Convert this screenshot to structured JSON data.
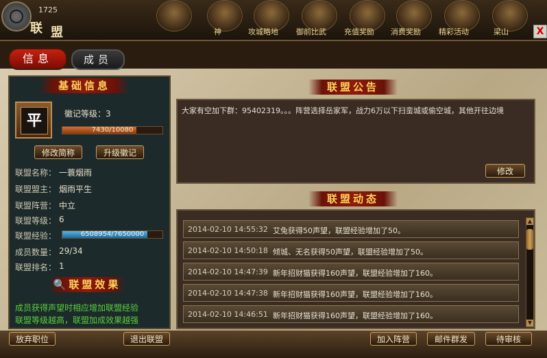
{
  "topbar": {
    "level": "1725",
    "title_char1": "联",
    "title_char2": "盟",
    "menu": [
      {
        "label": "",
        "icon": "portrait-icon"
      },
      {
        "label": "神",
        "icon": "weapon-icon"
      },
      {
        "label": "攻城略地",
        "icon": "jade-icon"
      },
      {
        "label": "御前比武",
        "icon": "dragon-icon"
      },
      {
        "label": "充值奖励",
        "icon": "gold-ingot-icon"
      },
      {
        "label": "消费奖励",
        "icon": "coin-icon"
      },
      {
        "label": "精彩活动",
        "icon": "gift-icon"
      },
      {
        "label": "梁山",
        "icon": "hero-icon"
      }
    ],
    "close": "X"
  },
  "tabs": {
    "info": "信息",
    "members": "成员"
  },
  "basic": {
    "banner": "基础信息",
    "badge_char": "平",
    "badge_level": "徽记等级：3",
    "badge_progress": "7430/10080",
    "badge_ratio": 0.737,
    "rename": "修改简称",
    "upgrade": "升级徽记",
    "fields": [
      {
        "label": "联盟名称：",
        "value": "一蓑烟雨"
      },
      {
        "label": "联盟盟主：",
        "value": "烟雨平生"
      },
      {
        "label": "联盟阵营：",
        "value": "中立"
      },
      {
        "label": "联盟等级：",
        "value": "6"
      },
      {
        "label": "联盟经验：",
        "value": ""
      },
      {
        "label": "成员数量：",
        "value": "29/34"
      },
      {
        "label": "联盟排名：",
        "value": "1"
      }
    ],
    "exp_progress": "6508954/7650000",
    "exp_ratio": 0.851,
    "effect_banner": "联盟效果",
    "effect_line1": "成员获得声望时相应增加联盟经验",
    "effect_line2": "联盟等级越高，联盟加成效果越强"
  },
  "announcement": {
    "banner": "联盟公告",
    "text": "大家有空加下群：95402319。。。阵营选择岳家军，战力6万以下扫蛮城或偷空城，其他开往边境",
    "modify": "修改"
  },
  "activity": {
    "banner": "联盟动态",
    "rows": [
      {
        "time": "2014-02-10  14:55:32",
        "text": "艾兔获得50声望，联盟经验增加了50。"
      },
      {
        "time": "2014-02-10  14:50:18",
        "text": "倾城、无名获得50声望，联盟经验增加了50。"
      },
      {
        "time": "2014-02-10  14:47:39",
        "text": "新年招财猫获得160声望，联盟经验增加了160。"
      },
      {
        "time": "2014-02-10  14:47:38",
        "text": "新年招财猫获得160声望，联盟经验增加了160。"
      },
      {
        "time": "2014-02-10  14:46:51",
        "text": "新年招财猫获得160声望，联盟经验增加了160。"
      }
    ]
  },
  "bottom": {
    "abandon": "放弃职位",
    "quit": "退出联盟",
    "join_camp": "加入阵营",
    "mass_mail": "邮件群发",
    "review": "待审核"
  }
}
